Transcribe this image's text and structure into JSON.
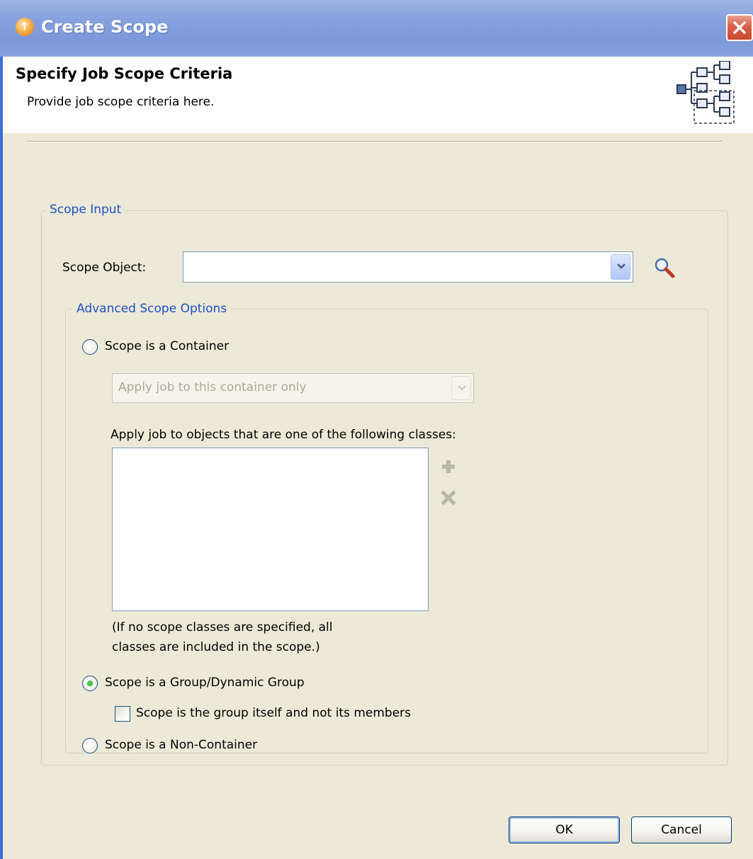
{
  "window": {
    "title": "Create Scope"
  },
  "header": {
    "title": "Specify Job Scope Criteria",
    "subtitle": "Provide job scope criteria here."
  },
  "scope_input": {
    "legend": "Scope Input",
    "scope_object_label": "Scope Object:",
    "scope_object_value": ""
  },
  "advanced": {
    "legend": "Advanced Scope Options",
    "container_option": {
      "label": "Scope is a Container",
      "selected": false,
      "apply_select_value": "Apply job to this container only",
      "classes_label": "Apply job to objects that are one of the following classes:",
      "classes": [],
      "note_line1": "(If no scope classes are specified, all",
      "note_line2": "classes are included in the scope.)"
    },
    "group_option": {
      "label": "Scope is a Group/Dynamic Group",
      "selected": true,
      "group_itself_label": "Scope is the group itself and not its members",
      "group_itself_checked": false
    },
    "noncontainer_option": {
      "label": "Scope is a Non-Container",
      "selected": false
    }
  },
  "buttons": {
    "ok": "OK",
    "cancel": "Cancel"
  },
  "icons": {
    "title": "scope-app-icon",
    "close": "close-icon",
    "banner": "hierarchy-tree-icon",
    "search": "magnifier-icon",
    "add": "add-icon",
    "remove": "remove-icon",
    "dropdown": "chevron-down-icon"
  },
  "colors": {
    "title_bar": "#7d99da",
    "dialog_bg": "#ece9d8",
    "legend_text": "#1e4fc2",
    "close_button": "#d9604a"
  }
}
